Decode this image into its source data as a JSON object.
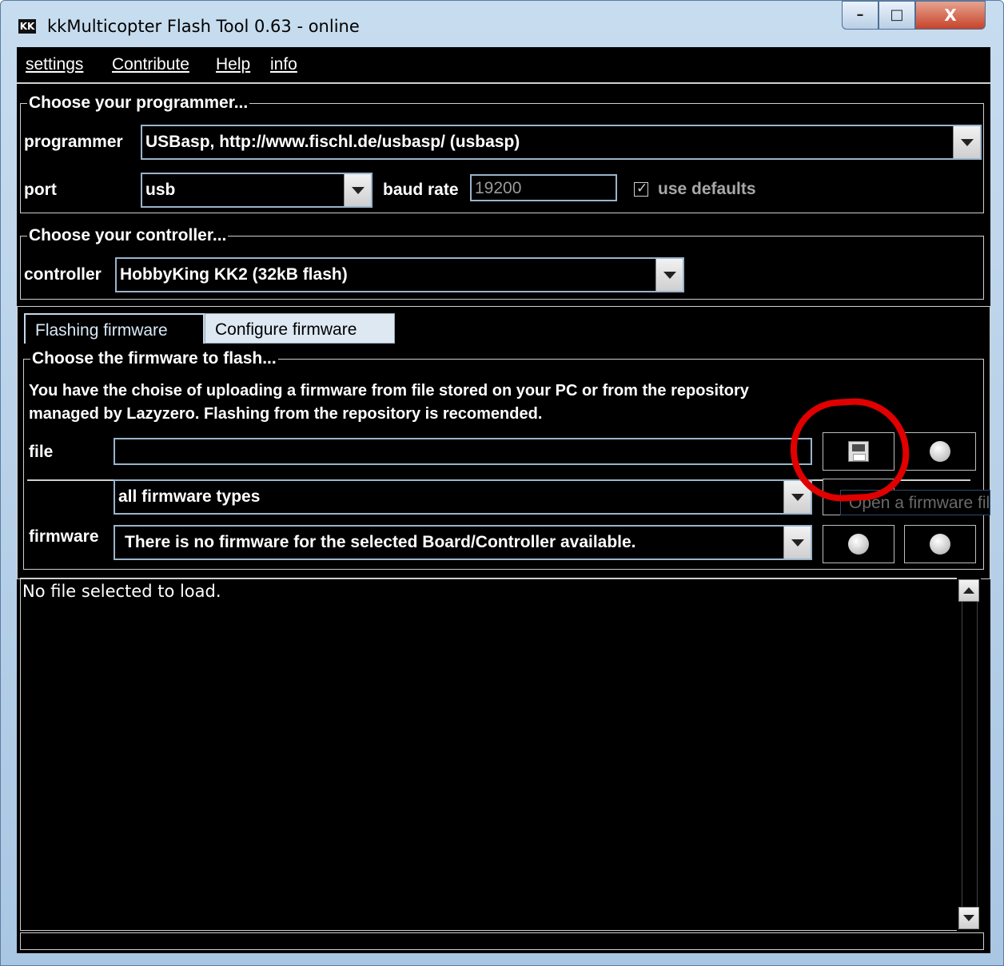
{
  "window": {
    "title": "kkMulticopter Flash Tool 0.63 - online",
    "icon_text": "KK",
    "controls": {
      "minimize": "–",
      "maximize": "□",
      "close": "X"
    }
  },
  "menu": [
    "settings",
    "Contribute",
    "Help",
    "info"
  ],
  "programmer_group": {
    "title": "Choose your programmer...",
    "programmer_label": "programmer",
    "programmer_value": "USBasp, http://www.fischl.de/usbasp/ (usbasp)",
    "port_label": "port",
    "port_value": "usb",
    "baud_label": "baud rate",
    "baud_value": "19200",
    "defaults_label": "use defaults",
    "defaults_checked": "✓"
  },
  "controller_group": {
    "title": "Choose your controller...",
    "controller_label": "controller",
    "controller_value": "HobbyKing KK2 (32kB flash)"
  },
  "tabs": [
    "Flashing firmware",
    "Configure firmware"
  ],
  "firmware_group": {
    "title": "Choose the firmware to flash...",
    "description_line1": "You have the choise of uploading a firmware from file stored on your PC or from the repository",
    "description_line2": "managed by Lazyzero. Flashing from the repository is recomended.",
    "file_label": "file",
    "file_value": "",
    "filter_value": "all firmware types",
    "firmware_label": "firmware",
    "firmware_value": "There is no firmware for the selected Board/Controller available.",
    "tooltip": "Open a firmware file",
    "info_icon_mark": "i"
  },
  "log": {
    "text": "No file selected to load."
  },
  "colors": {
    "highlight": "#e00000",
    "background": "#000000",
    "text": "#ffffff"
  }
}
